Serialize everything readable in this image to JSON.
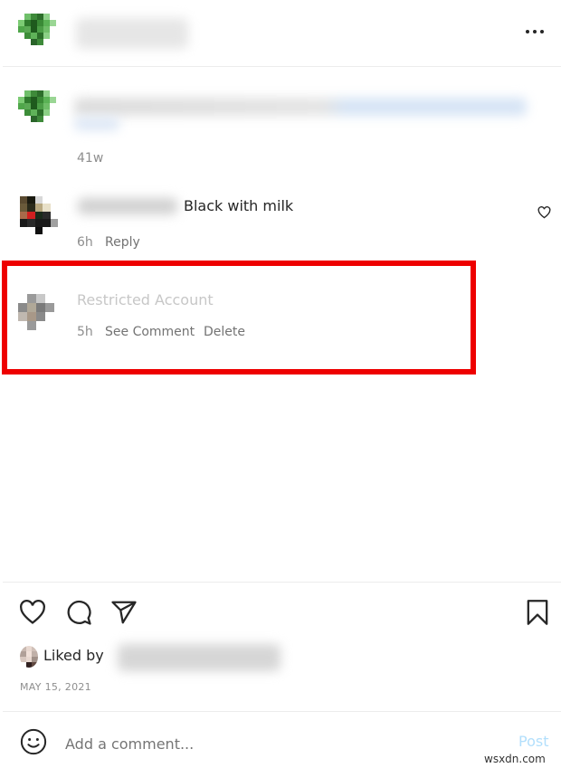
{
  "header": {
    "more_icon": "more-horizontal-icon"
  },
  "caption": {
    "time": "41w"
  },
  "comments": [
    {
      "text": "Black with milk",
      "time": "6h",
      "reply_label": "Reply",
      "like_icon": "heart-outline-icon"
    },
    {
      "author": "Restricted Account",
      "time": "5h",
      "see_comment_label": "See Comment",
      "delete_label": "Delete"
    }
  ],
  "highlight_color": "#ee0000",
  "actions": {
    "icons": [
      "heart-icon",
      "comment-icon",
      "share-icon",
      "bookmark-icon"
    ]
  },
  "likes": {
    "label": "Liked by"
  },
  "date": "MAY 15, 2021",
  "comment_box": {
    "placeholder": "Add a comment...",
    "post_label": "Post",
    "emoji_icon": "smiley-icon"
  },
  "watermark": "wsxdn.com"
}
